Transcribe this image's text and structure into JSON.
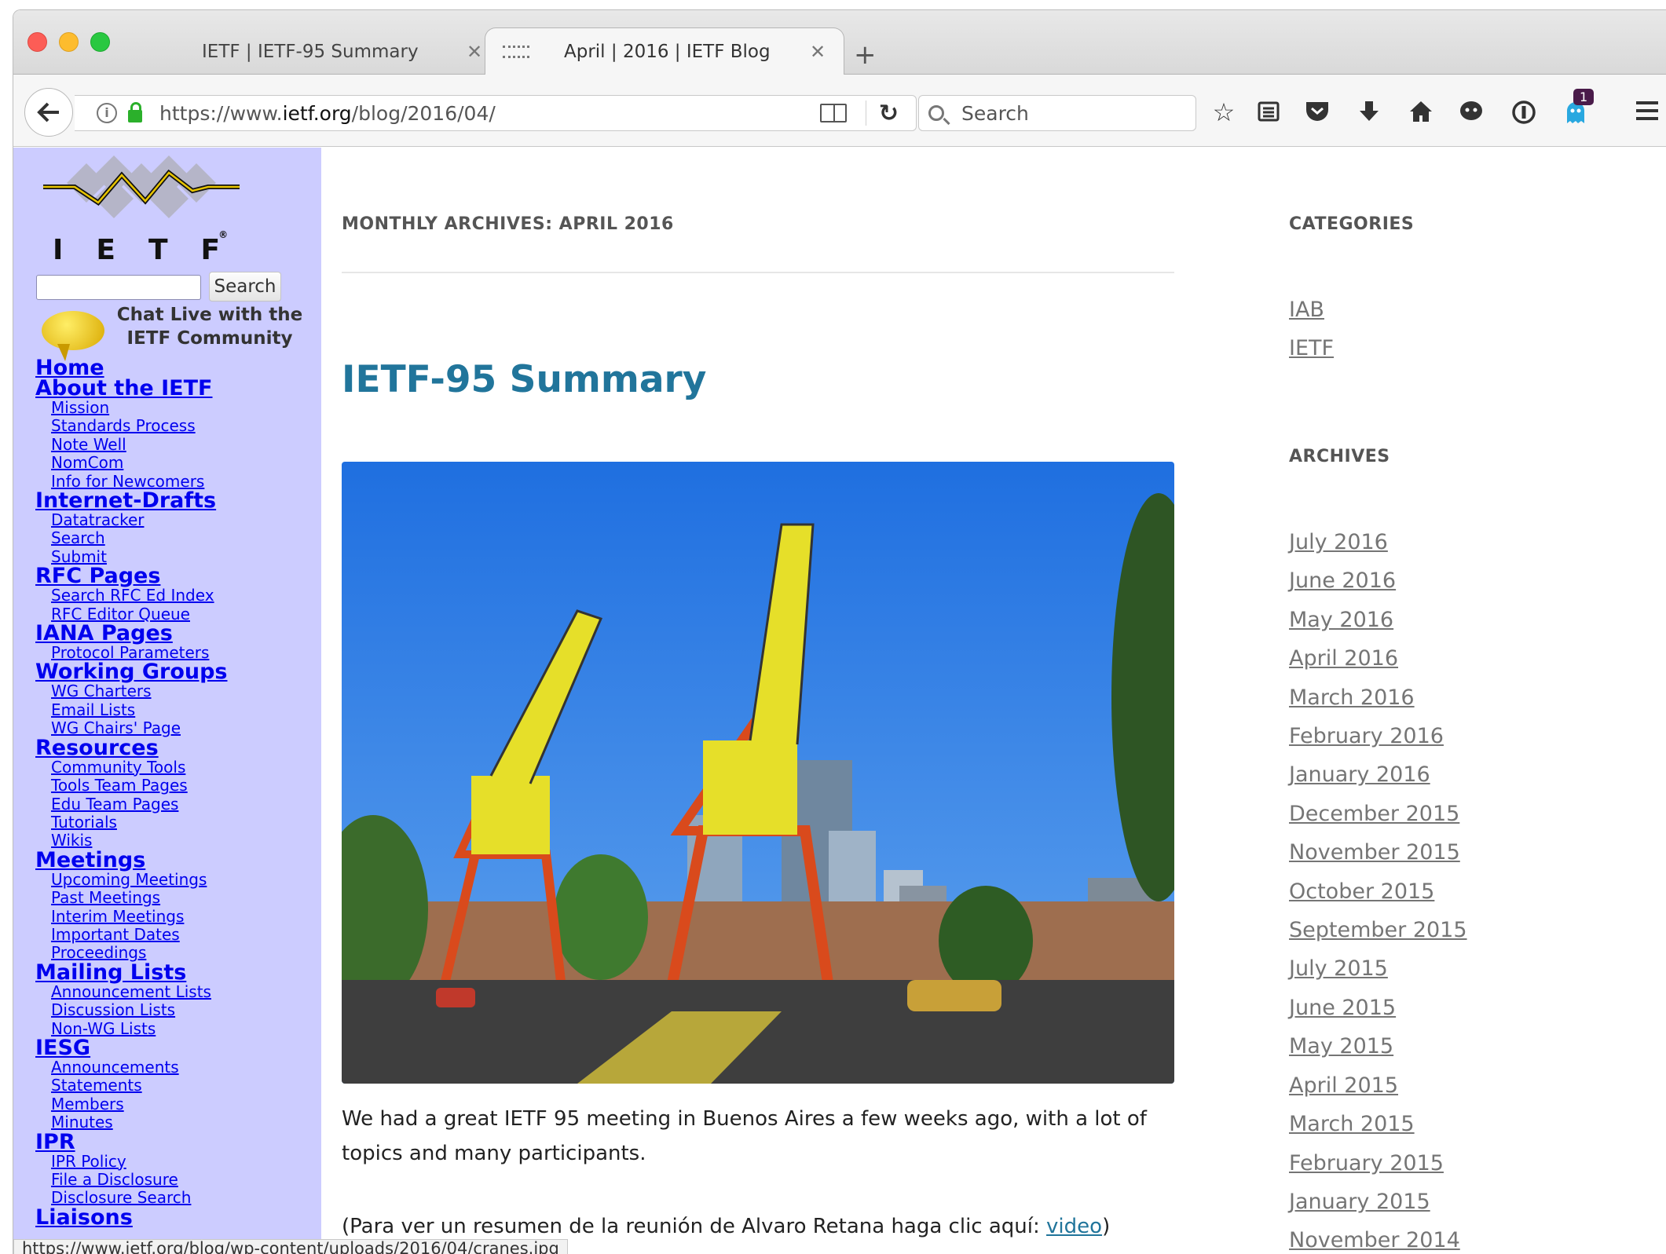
{
  "browser": {
    "tabs": [
      {
        "title": "IETF | IETF-95 Summary",
        "active": false
      },
      {
        "title": "April | 2016 | IETF Blog",
        "active": true
      }
    ],
    "url_prefix": "https://www.",
    "url_domain": "ietf.org",
    "url_path": "/blog/2016/04/",
    "search_placeholder": "Search",
    "notification_count": "1",
    "status_url": "https://www.ietf.org/blog/wp-content/uploads/2016/04/cranes.jpg"
  },
  "sidebar": {
    "logo_text": "IETF",
    "logo_registered": "®",
    "search_button": "Search",
    "chat_line1": "Chat Live with the",
    "chat_line2": "IETF Community",
    "nav": [
      {
        "label": "Home",
        "items": []
      },
      {
        "label": "About the IETF",
        "items": [
          "Mission",
          "Standards Process",
          "Note Well",
          "NomCom",
          "Info for Newcomers"
        ]
      },
      {
        "label": "Internet-Drafts",
        "items": [
          "Datatracker",
          "Search",
          "Submit"
        ]
      },
      {
        "label": "RFC Pages",
        "items": [
          "Search RFC Ed Index",
          "RFC Editor Queue"
        ]
      },
      {
        "label": "IANA Pages",
        "items": [
          "Protocol Parameters"
        ]
      },
      {
        "label": "Working Groups",
        "items": [
          "WG Charters",
          "Email Lists",
          "WG Chairs' Page"
        ]
      },
      {
        "label": "Resources",
        "items": [
          "Community Tools",
          "Tools Team Pages",
          "Edu Team Pages",
          "Tutorials",
          "Wikis"
        ]
      },
      {
        "label": "Meetings",
        "items": [
          "Upcoming Meetings",
          "Past Meetings",
          "Interim Meetings",
          "Important Dates",
          "Proceedings"
        ]
      },
      {
        "label": "Mailing Lists",
        "items": [
          "Announcement Lists",
          "Discussion Lists",
          "Non-WG Lists"
        ]
      },
      {
        "label": "IESG",
        "items": [
          "Announcements",
          "Statements",
          "Members",
          "Minutes"
        ]
      },
      {
        "label": "IPR",
        "items": [
          "IPR Policy",
          "File a Disclosure",
          "Disclosure Search"
        ]
      },
      {
        "label": "Liaisons",
        "items": []
      }
    ]
  },
  "main": {
    "archive_title": "MONTHLY ARCHIVES: APRIL 2016",
    "post_title": "IETF-95 Summary",
    "paragraph1": "We had a great IETF 95 meeting in Buenos Aires a few weeks ago, with a lot of topics and many participants.",
    "paragraph2_text": "(Para ver un resumen de la reunión de Alvaro Retana haga clic aquí: ",
    "paragraph2_link": "video",
    "paragraph2_end": ")"
  },
  "right": {
    "categories_title": "CATEGORIES",
    "categories": [
      "IAB",
      "IETF"
    ],
    "archives_title": "ARCHIVES",
    "archives": [
      "July 2016",
      "June 2016",
      "May 2016",
      "April 2016",
      "March 2016",
      "February 2016",
      "January 2016",
      "December 2015",
      "November 2015",
      "October 2015",
      "September 2015",
      "July 2015",
      "June 2015",
      "May 2015",
      "April 2015",
      "March 2015",
      "February 2015",
      "January 2015",
      "November 2014"
    ]
  }
}
